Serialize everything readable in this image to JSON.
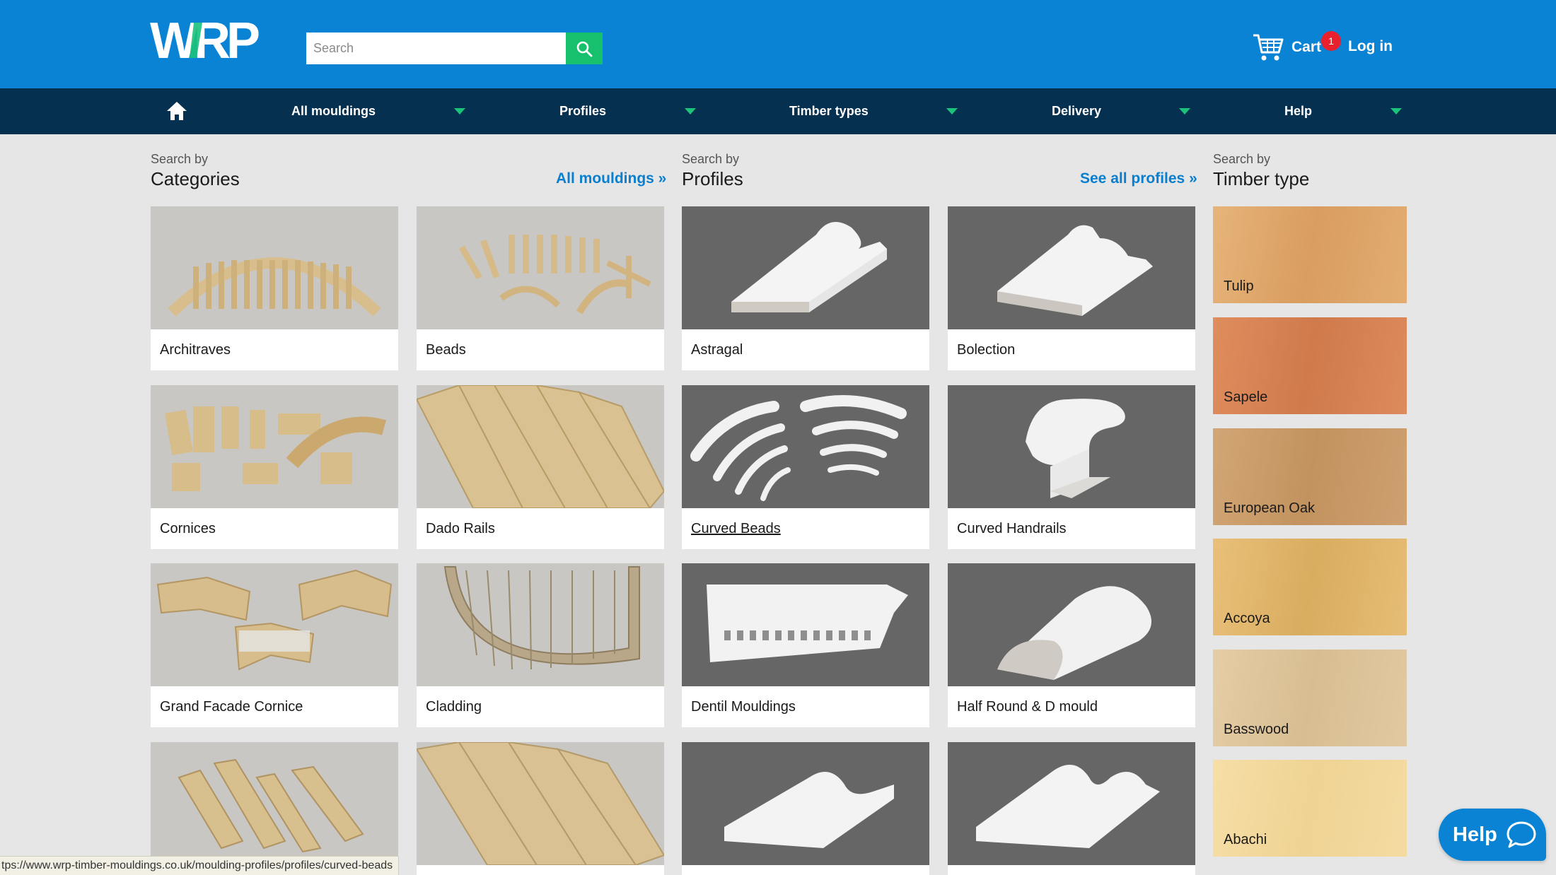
{
  "header": {
    "logo_text": "WRP",
    "search_placeholder": "Search",
    "cart_label": "Cart",
    "cart_count": "1",
    "login_label": "Log in"
  },
  "nav": {
    "items": [
      {
        "label": "All mouldings"
      },
      {
        "label": "Profiles"
      },
      {
        "label": "Timber types"
      },
      {
        "label": "Delivery"
      },
      {
        "label": "Help"
      }
    ]
  },
  "categories": {
    "small": "Search by",
    "title": "Categories",
    "link": "All mouldings »",
    "items": [
      {
        "label": "Architraves"
      },
      {
        "label": "Beads"
      },
      {
        "label": "Cornices"
      },
      {
        "label": "Dado Rails"
      },
      {
        "label": "Grand Facade Cornice"
      },
      {
        "label": "Cladding"
      },
      {
        "label": ""
      },
      {
        "label": ""
      }
    ]
  },
  "profiles": {
    "small": "Search by",
    "title": "Profiles",
    "link": "See all profiles »",
    "items": [
      {
        "label": "Astragal"
      },
      {
        "label": "Bolection"
      },
      {
        "label": "Curved Beads"
      },
      {
        "label": "Curved Handrails"
      },
      {
        "label": "Dentil Mouldings"
      },
      {
        "label": "Half Round & D mould"
      },
      {
        "label": ""
      },
      {
        "label": ""
      }
    ]
  },
  "timber": {
    "small": "Search by",
    "title": "Timber type",
    "items": [
      {
        "label": "Tulip",
        "color": "#dba368"
      },
      {
        "label": "Sapele",
        "color": "#d9845a"
      },
      {
        "label": "European Oak",
        "color": "#c99c6a"
      },
      {
        "label": "Accoya",
        "color": "#e3bb72"
      },
      {
        "label": "Basswood",
        "color": "#dec59e"
      },
      {
        "label": "Abachi",
        "color": "#f3d99e"
      }
    ]
  },
  "status_url": "tps://www.wrp-timber-mouldings.co.uk/moulding-profiles/profiles/curved-beads",
  "help_widget": {
    "label": "Help"
  },
  "colors": {
    "header": "#0a83d4",
    "nav": "#05304f",
    "accent": "#1bc27a",
    "link": "#0a7fd0"
  }
}
